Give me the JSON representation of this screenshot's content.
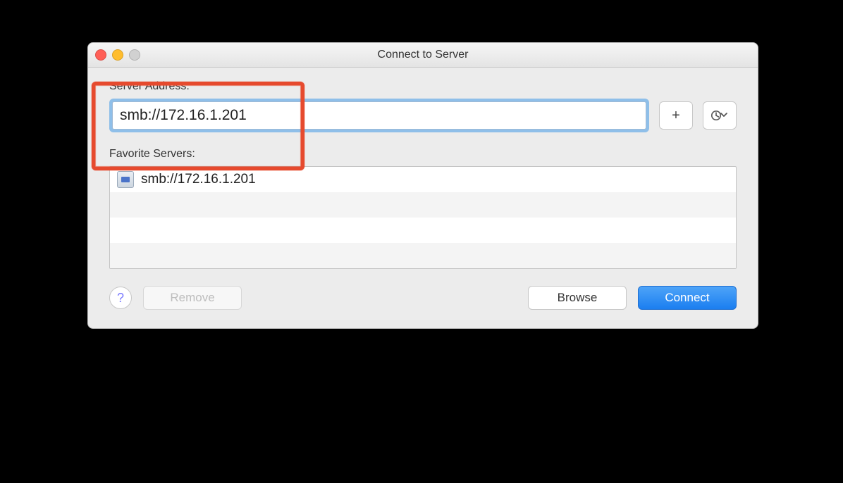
{
  "window": {
    "title": "Connect to Server"
  },
  "labels": {
    "server_address": "Server Address:",
    "favorite_servers": "Favorite Servers:"
  },
  "address": {
    "value": "smb://172.16.1.201"
  },
  "favorites": {
    "items": [
      {
        "url": "smb://172.16.1.201"
      }
    ]
  },
  "buttons": {
    "remove": "Remove",
    "browse": "Browse",
    "connect": "Connect",
    "help": "?"
  },
  "icons": {
    "add": "+"
  }
}
